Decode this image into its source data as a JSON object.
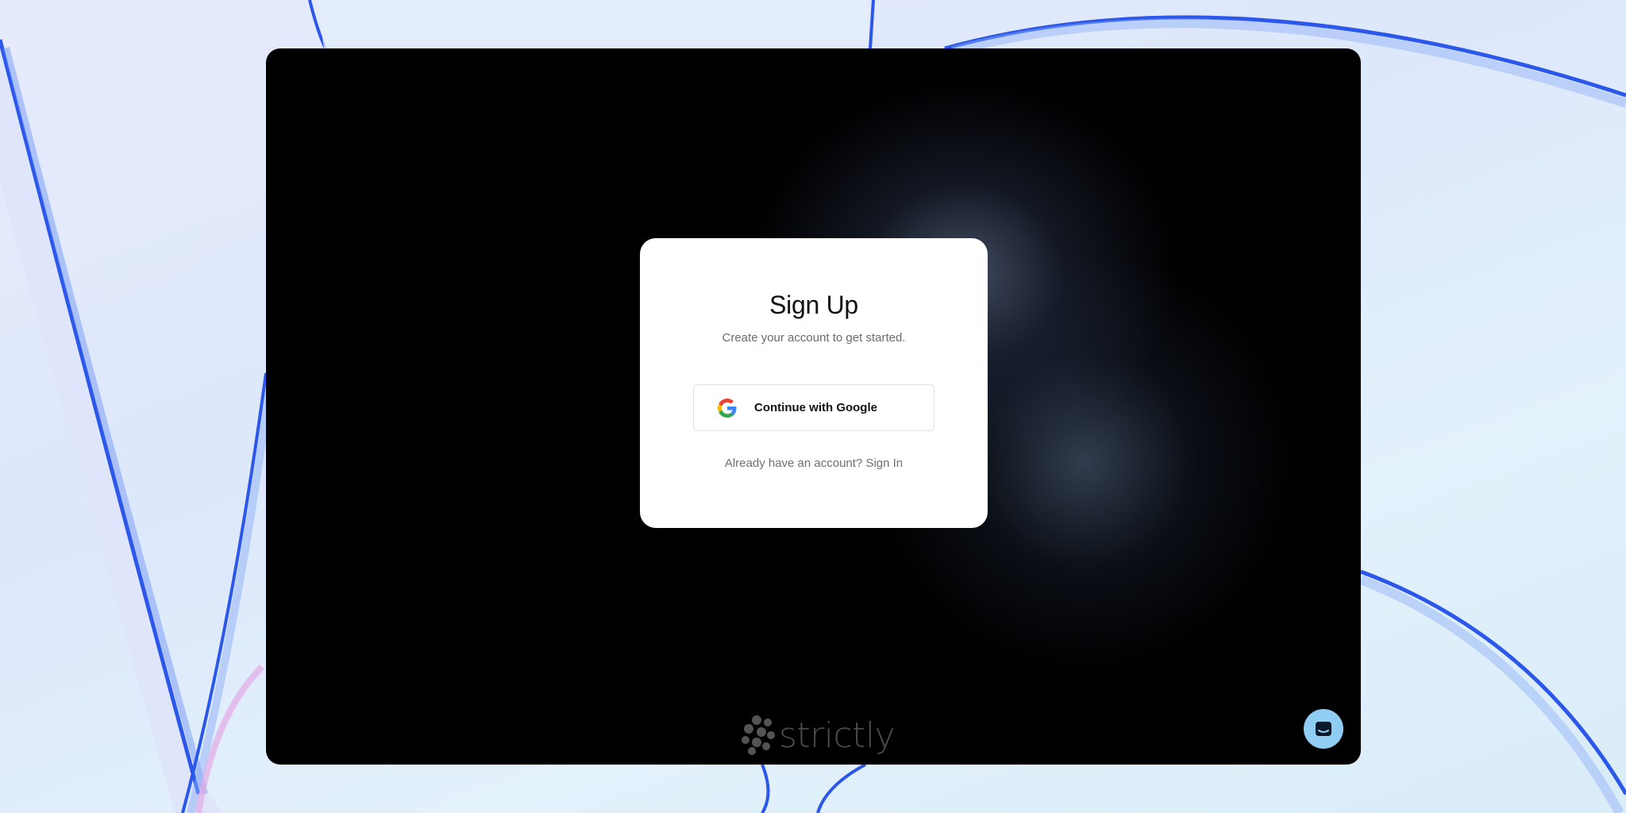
{
  "card": {
    "title": "Sign Up",
    "subtitle": "Create your account to get started.",
    "google_button_label": "Continue with Google",
    "signin_prompt": "Already have an account? Sign In"
  },
  "brand": {
    "name": "strictly"
  },
  "icons": {
    "google": "google-icon",
    "brand": "strictly-logo-mark",
    "chat": "chat-icon"
  },
  "colors": {
    "window_background": "#000000",
    "card_background": "#ffffff",
    "chat_launcher": "#8fcdf3",
    "wallpaper_accent": "#2f5bea"
  }
}
